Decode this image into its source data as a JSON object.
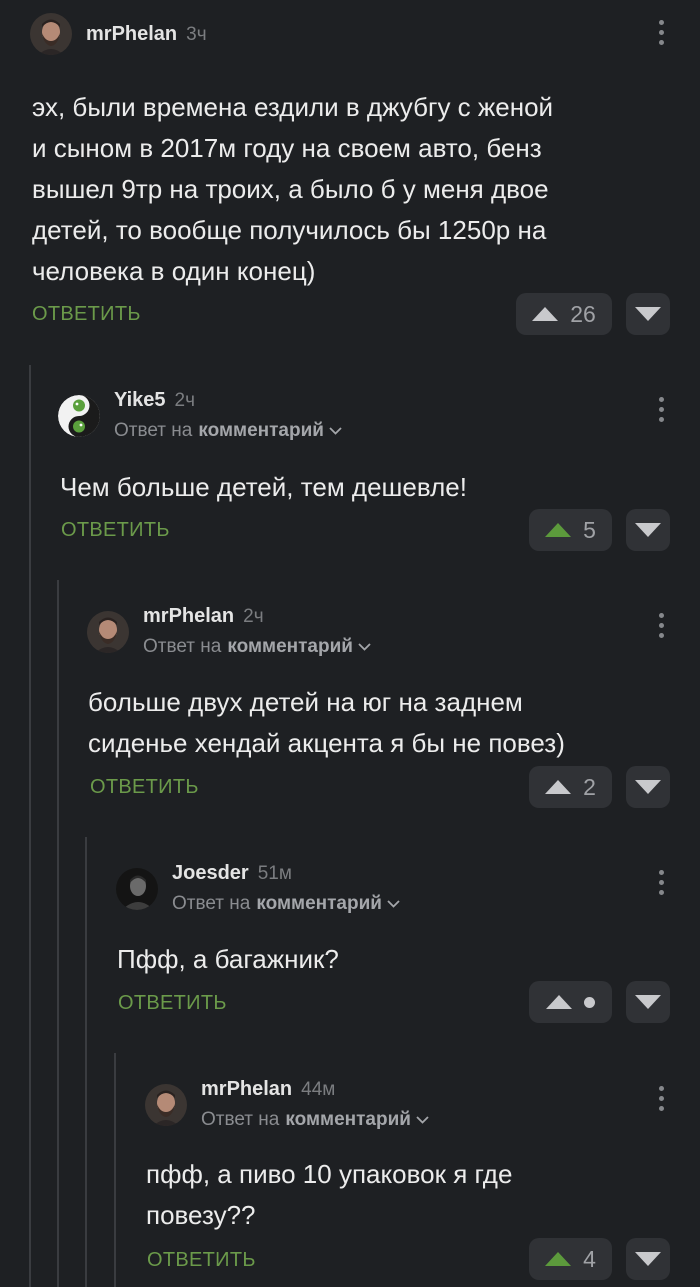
{
  "labels": {
    "reply": "ОТВЕТИТЬ",
    "reply_to": "Ответ на",
    "reply_to_target": "комментарий"
  },
  "colors": {
    "background": "#1e2023",
    "reply_green": "#6b9a4a",
    "upvote_active": "#5c9a3c",
    "button_bg": "#303236"
  },
  "comments": [
    {
      "username": "mrPhelan",
      "time": "3ч",
      "text": "эх, были времена ездили в джубгу с женой\nи сыном в 2017м году на своем авто, бенз\nвышел 9тр на троих, а было б у меня двое\nдетей, то вообще получилось бы 1250р на\nчеловека в один конец)",
      "rating": "26",
      "upvoted": false,
      "avatar_icon": "bearded-man-avatar"
    },
    {
      "username": "Yike5",
      "time": "2ч",
      "text": "Чем больше детей, тем дешевле!",
      "rating": "5",
      "upvoted": true,
      "avatar_icon": "yin-yang-frog-avatar"
    },
    {
      "username": "mrPhelan",
      "time": "2ч",
      "text": "больше двух детей на юг на заднем\nсиденье хендай акцента я бы не повез)",
      "rating": "2",
      "upvoted": false,
      "avatar_icon": "bearded-man-avatar"
    },
    {
      "username": "Joesder",
      "time": "51м",
      "text": "Пфф, а багажник?",
      "rating": "",
      "upvoted": false,
      "avatar_icon": "dark-portrait-avatar"
    },
    {
      "username": "mrPhelan",
      "time": "44м",
      "text": "пфф, а пиво 10 упаковок я где\nповезу??",
      "rating": "4",
      "upvoted": true,
      "avatar_icon": "bearded-man-avatar"
    }
  ]
}
